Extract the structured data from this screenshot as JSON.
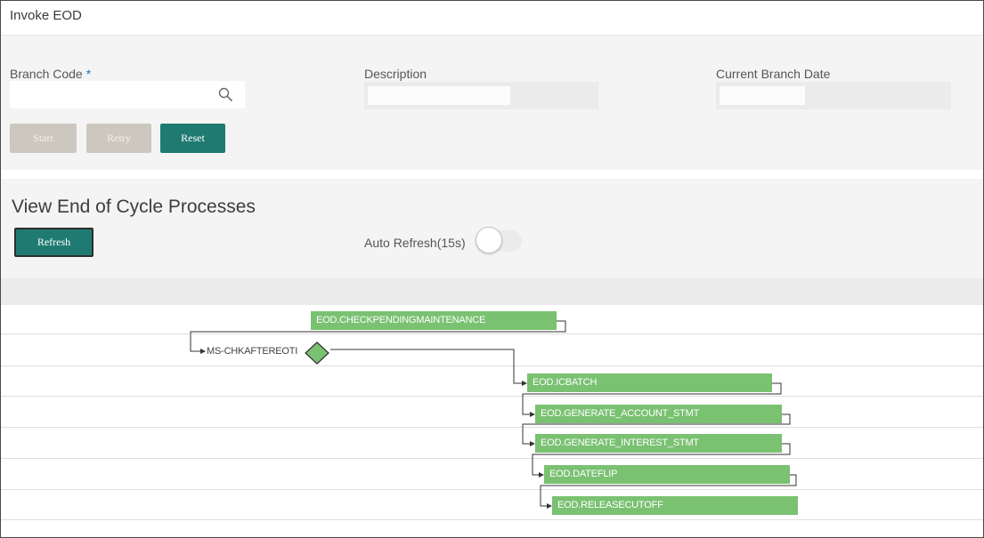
{
  "window": {
    "title": "Invoke EOD"
  },
  "form": {
    "branch_code": {
      "label": "Branch Code",
      "required_mark": "*",
      "value": "",
      "icon": "search-icon"
    },
    "description": {
      "label": "Description",
      "value": ""
    },
    "current_branch_date": {
      "label": "Current Branch Date",
      "value": ""
    }
  },
  "buttons": {
    "start": "Start",
    "retry": "Retry",
    "reset": "Reset"
  },
  "processes": {
    "title": "View End of Cycle Processes",
    "refresh_label": "Refresh",
    "auto_refresh_label": "Auto Refresh(15s)",
    "auto_refresh_on": false
  },
  "flow": {
    "nodes": [
      "EOD.CHECKPENDINGMAINTENANCE",
      "MS-CHKAFTEREOTI",
      "EOD.ICBATCH",
      "EOD.GENERATE_ACCOUNT_STMT",
      "EOD.GENERATE_INTEREST_STMT",
      "EOD.DATEFLIP",
      "EOD.RELEASECUTOFF"
    ]
  },
  "colors": {
    "primary_button": "#1f7a72",
    "disabled_button": "#cdc8bf",
    "node_fill": "#7ac172",
    "required_mark": "#1f7aa8"
  }
}
